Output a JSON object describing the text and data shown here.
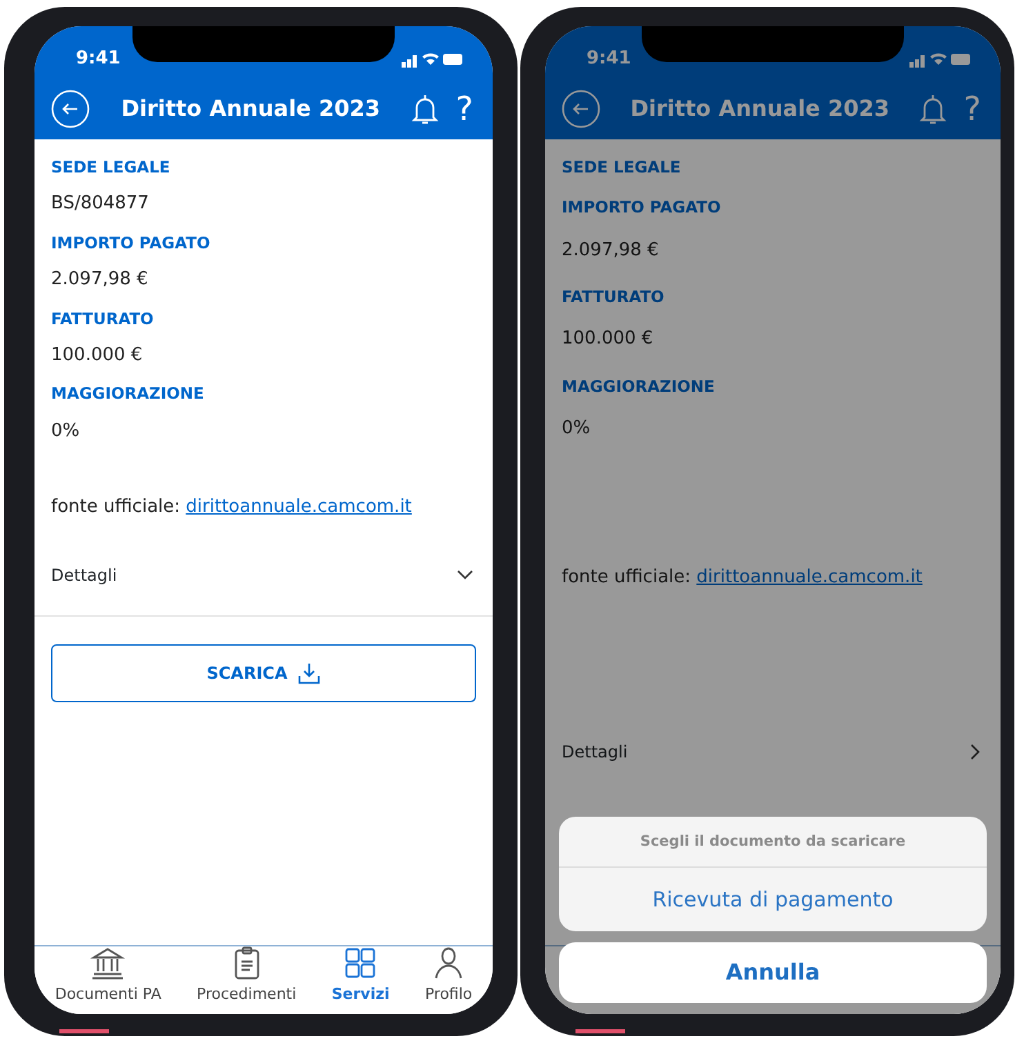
{
  "phones": [
    {
      "status_time": "9:41",
      "title": "Diritto Annuale 2023",
      "help_glyph": "?",
      "dimmed": false,
      "fields": [
        {
          "label": "SEDE LEGALE",
          "value": "BS/804877"
        },
        {
          "label": "IMPORTO PAGATO",
          "value": "2.097,98 €"
        },
        {
          "label": "FATTURATO",
          "value": "100.000 €"
        },
        {
          "label": "MAGGIORAZIONE",
          "value": "0%"
        }
      ],
      "source": {
        "prefix": "fonte ufficiale:",
        "link": "dirittoannuale.camcom.it"
      },
      "details": {
        "label": "Dettagli",
        "expanded": true
      },
      "download_button": "SCARICA",
      "tabs": [
        {
          "label": "Documenti PA",
          "selected": false
        },
        {
          "label": "Procedimenti",
          "selected": false
        },
        {
          "label": "Servizi",
          "selected": true
        },
        {
          "label": "Profilo",
          "selected": false
        }
      ]
    },
    {
      "status_time": "9:41",
      "title": "Diritto Annuale 2023",
      "help_glyph": "?",
      "dimmed": true,
      "fields": [
        {
          "label": "SEDE LEGALE"
        },
        {
          "label": "IMPORTO PAGATO",
          "value": "2.097,98 €"
        },
        {
          "label": "FATTURATO",
          "value": "100.000 €"
        },
        {
          "label": "MAGGIORAZIONE",
          "value": "0%"
        }
      ],
      "source": {
        "prefix": "fonte ufficiale:",
        "link": "dirittoannuale.camcom.it"
      },
      "details": {
        "label": "Dettagli",
        "expanded": false
      },
      "action_sheet": {
        "title": "Scegli il documento da scaricare",
        "options": [
          "Ricevuta di pagamento"
        ],
        "cancel": "Annulla"
      }
    }
  ]
}
